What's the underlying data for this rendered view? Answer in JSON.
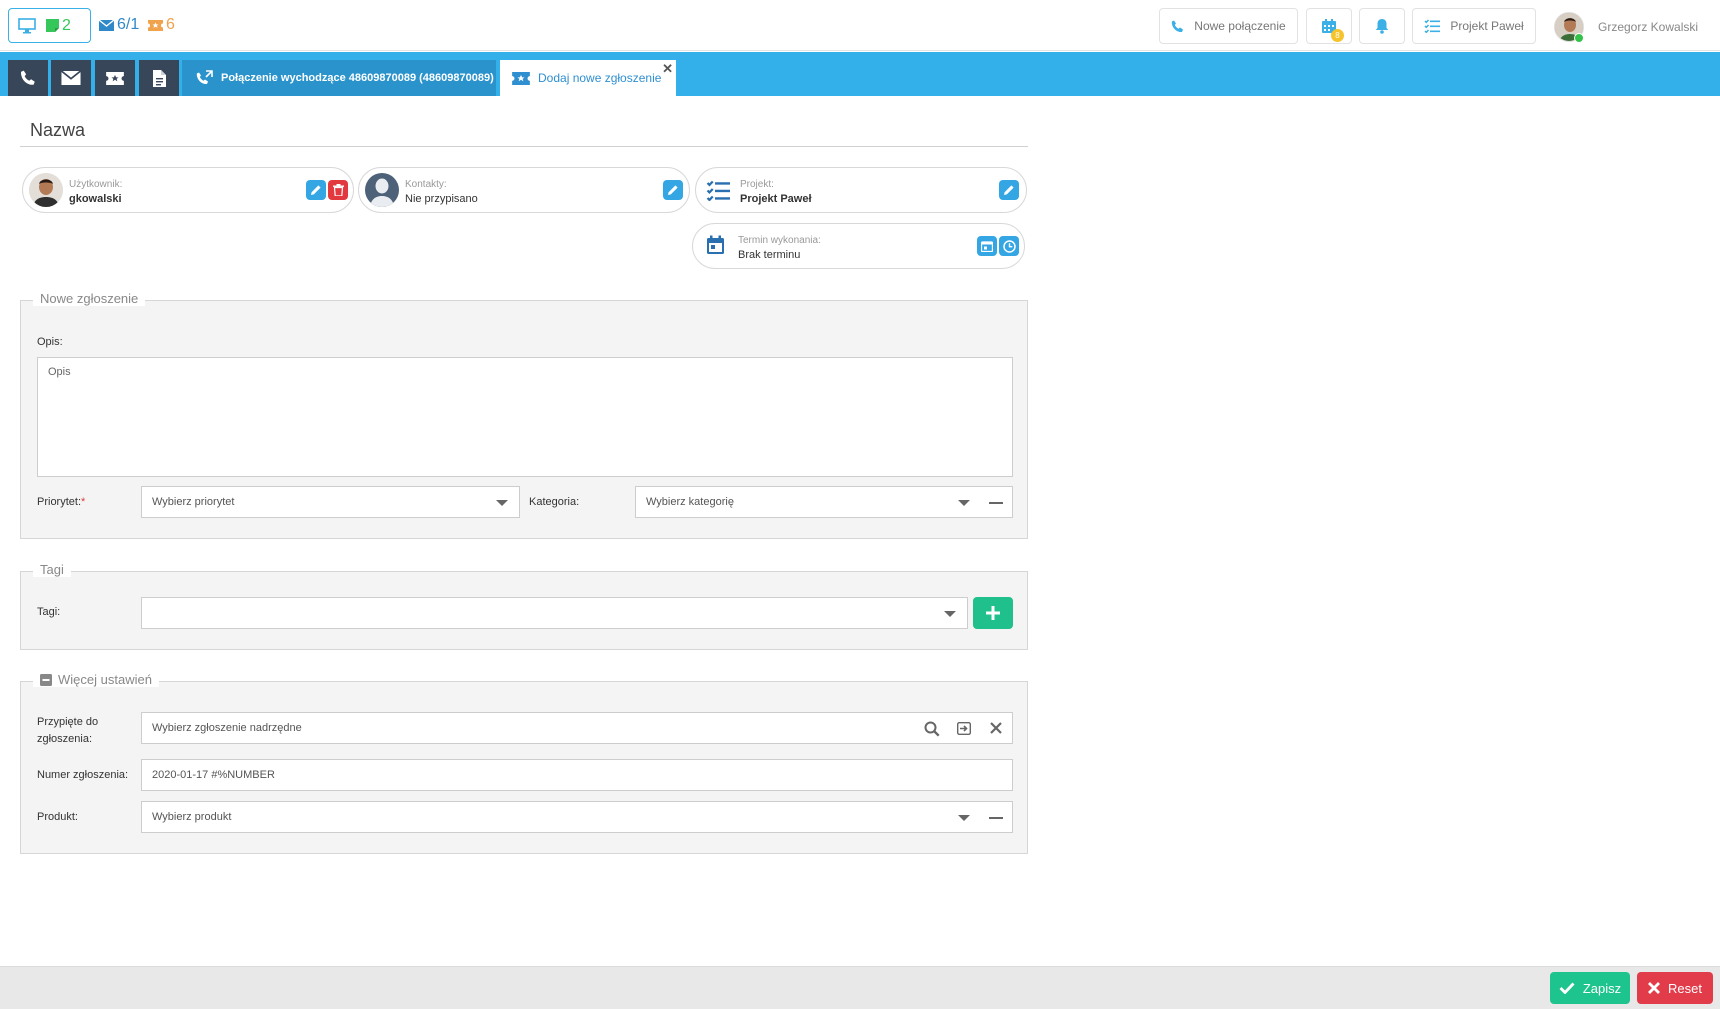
{
  "topbar": {
    "status_count": "2",
    "mail_count": "6/1",
    "ticket_count": "6",
    "new_call_label": "Nowe połączenie",
    "calendar_badge": "8",
    "project_label": "Projekt Paweł",
    "user_name": "Grzegorz Kowalski"
  },
  "tabs": {
    "connection_label": "Połączenie wychodzące 48609870089 (48609870089)",
    "new_ticket_label": "Dodaj nowe zgłoszenie",
    "close_glyph": "✕"
  },
  "page": {
    "title": "Nazwa"
  },
  "info": {
    "user_label": "Użytkownik:",
    "user_value": "gkowalski",
    "contacts_label": "Kontakty:",
    "contacts_value": "Nie przypisano",
    "project_label": "Projekt:",
    "project_value": "Projekt Paweł",
    "deadline_label": "Termin wykonania:",
    "deadline_value": "Brak terminu"
  },
  "new_ticket": {
    "legend": "Nowe zgłoszenie",
    "description_label": "Opis:",
    "description_placeholder": "Opis",
    "priority_label": "Priorytet:",
    "priority_required": "*",
    "priority_placeholder": "Wybierz priorytet",
    "category_label": "Kategoria:",
    "category_placeholder": "Wybierz kategorię"
  },
  "tags": {
    "legend": "Tagi",
    "tags_label": "Tagi:",
    "tags_value": ""
  },
  "more": {
    "legend": "Więcej ustawień",
    "attached_label_line1": "Przypięte do",
    "attached_label_line2": "zgłoszenia:",
    "attached_placeholder": "Wybierz zgłoszenie nadrzędne",
    "number_label": "Numer zgłoszenia:",
    "number_value": "2020-01-17 #%NUMBER",
    "product_label": "Produkt:",
    "product_placeholder": "Wybierz produkt"
  },
  "footer": {
    "save_label": "Zapisz",
    "reset_label": "Reset"
  },
  "colors": {
    "accent": "#33b0ea",
    "dark_tab": "#38465a",
    "success": "#1ec48d",
    "danger": "#e23b4a"
  }
}
